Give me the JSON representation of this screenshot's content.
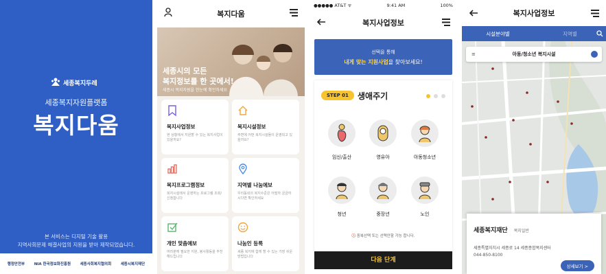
{
  "splash": {
    "brand": "세종복지두레",
    "subtitle": "세종복지자원플랫폼",
    "app_name": "복지다움",
    "notice_line1": "본 서비스는 디지털 기술 활용",
    "notice_line2": "지역사회문제 해결사업의 지원을 받아 제작되었습니다.",
    "footer_logos": [
      "행정안전부",
      "NIA 한국정보화진흥원",
      "세종사회복지협의회",
      "세종시복지재단"
    ]
  },
  "home": {
    "title": "복지다움",
    "hero_line1": "세종시의 모든",
    "hero_line2": "복지정보를 한 곳에서!",
    "hero_line3": "세종시 복지자원을 한눈에 확인하세요",
    "cards": [
      {
        "title": "복지사업정보",
        "desc": "현 상황에서 지원할 수 있는 복지사업이 있을까요?",
        "icon": "bookmark-icon",
        "color": "#7a5ee0"
      },
      {
        "title": "복지시설정보",
        "desc": "주변에 어떤 복지시설들이 운영되고 있을까요?",
        "icon": "home-icon",
        "color": "#f3a43b"
      },
      {
        "title": "복지프로그램정보",
        "desc": "복지시설에서 운영하는 프로그램 조회/신청합니다",
        "icon": "bar-chart-icon",
        "color": "#e36a5a"
      },
      {
        "title": "지역별 나눔에보",
        "desc": "우리동네의 복지수준은 어떨까 궁금하시다면 확인하세요",
        "icon": "map-pin-icon",
        "color": "#4b8ee8"
      },
      {
        "title": "개인 맞춤예보",
        "desc": "여러분께 필요한 지원, 봉사활동을 추천해드립니다",
        "icon": "checkbox-icon",
        "color": "#5ab76a"
      },
      {
        "title": "나눔인 등록",
        "desc": "세종 복지에 함께 할 수 있는 가장 쉬운 방법입니다",
        "icon": "smile-icon",
        "color": "#f3a43b"
      }
    ]
  },
  "business": {
    "status": {
      "carrier": "●●●●● AT&T ᯤ",
      "time": "9:41 AM",
      "battery": "100%"
    },
    "title": "복지사업정보",
    "banner_line1": "선택을 통해",
    "banner_highlight": "내게 맞는 지원사업",
    "banner_rest": "을 찾아보세요!",
    "step_badge": "STEP 01",
    "step_title": "생애주기",
    "life_stages": [
      "임신/출산",
      "영유아",
      "아동청소년",
      "청년",
      "중장년",
      "노인"
    ],
    "note_prefix": "ⓘ",
    "note_text": "중복선택 또는 선택안함 가능 합니다.",
    "next_button": "다음 단계"
  },
  "facility": {
    "title": "복지사업정보",
    "tab_active": "시설분야별",
    "tab_inactive": "지역별",
    "filter_label": "아동/청소년 복지시설",
    "org_name": "세종복지재단",
    "org_type": "복지일반",
    "address": "세종특별자치시 세종로 14 세종종합복지센터",
    "phone": "044-850-8100",
    "detail_button": "상세보기 >"
  },
  "colors": {
    "primary": "#3b63b8",
    "accent": "#f7c32e",
    "splash_bg": "#2f5fc4"
  }
}
